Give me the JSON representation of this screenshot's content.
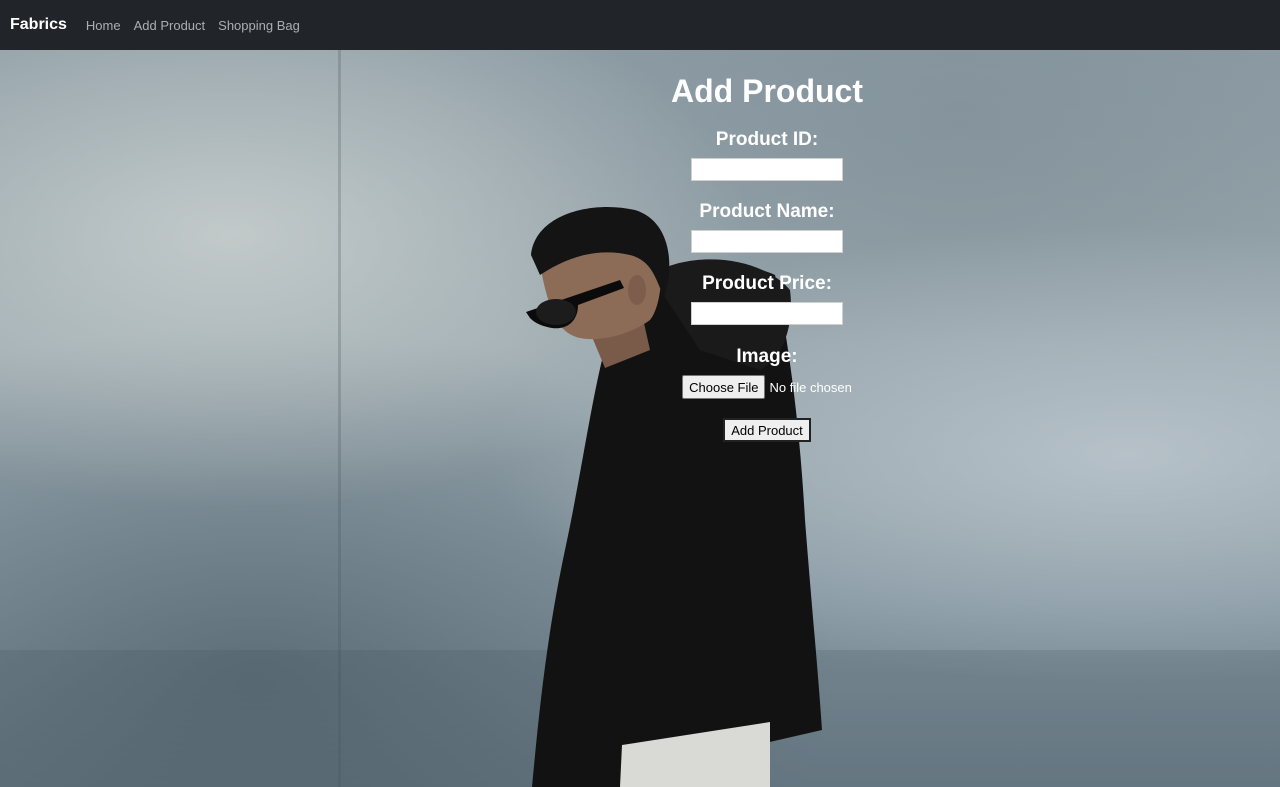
{
  "navbar": {
    "brand": "Fabrics",
    "links": [
      "Home",
      "Add Product",
      "Shopping Bag"
    ]
  },
  "form": {
    "title": "Add Product",
    "fields": [
      {
        "label": "Product ID:",
        "value": "",
        "placeholder": ""
      },
      {
        "label": "Product Name:",
        "value": "",
        "placeholder": ""
      },
      {
        "label": "Product Price:",
        "value": "",
        "placeholder": ""
      }
    ],
    "image_label": "Image:",
    "choose_file_label": "Choose File",
    "file_status": "No file chosen",
    "submit_label": "Add Product"
  },
  "colors": {
    "navbar_bg": "#212529",
    "brand": "#ffffff",
    "nav_link": "#a6a9ac",
    "form_text": "#ffffff"
  }
}
